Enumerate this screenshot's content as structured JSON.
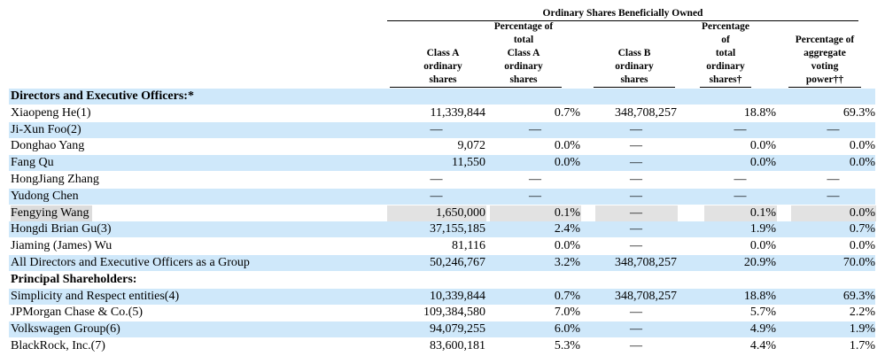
{
  "table": {
    "super_header": "Ordinary Shares Beneficially Owned",
    "columns": [
      [
        "Class A",
        "ordinary",
        "shares"
      ],
      [
        "Percentage of",
        "total",
        "Class A",
        "ordinary",
        "shares"
      ],
      [
        "Class B",
        "ordinary",
        "shares"
      ],
      [
        "Percentage",
        "of",
        "total",
        "ordinary",
        "shares†"
      ],
      [
        "Percentage of",
        "aggregate",
        "voting",
        "power††"
      ]
    ],
    "rows": [
      {
        "type": "section",
        "label": "Directors and Executive Officers:*"
      },
      {
        "label": "Xiaopeng He(1)",
        "values": [
          "11,339,844",
          "0.7%",
          "348,708,257",
          "18.8%",
          "69.3%"
        ]
      },
      {
        "label": "Ji-Xun Foo(2)",
        "values": [
          "—",
          "—",
          "—",
          "—",
          "—"
        ]
      },
      {
        "label": "Donghao Yang",
        "values": [
          "9,072",
          "0.0%",
          "—",
          "0.0%",
          "0.0%"
        ]
      },
      {
        "label": "Fang Qu",
        "values": [
          "11,550",
          "0.0%",
          "—",
          "0.0%",
          "0.0%"
        ]
      },
      {
        "label": "HongJiang Zhang",
        "values": [
          "—",
          "—",
          "—",
          "—",
          "—"
        ]
      },
      {
        "label": "Yudong Chen",
        "values": [
          "—",
          "—",
          "—",
          "—",
          "—"
        ]
      },
      {
        "label": "Fengying Wang",
        "values": [
          "1,650,000",
          "0.1%",
          "—",
          "0.1%",
          "0.0%"
        ],
        "highlight": true
      },
      {
        "label": "Hongdi Brian Gu(3)",
        "values": [
          "37,155,185",
          "2.4%",
          "—",
          "1.9%",
          "0.7%"
        ]
      },
      {
        "label": "Jiaming (James) Wu",
        "values": [
          "81,116",
          "0.0%",
          "—",
          "0.0%",
          "0.0%"
        ]
      },
      {
        "label": "All Directors and Executive Officers as a Group",
        "values": [
          "50,246,767",
          "3.2%",
          "348,708,257",
          "20.9%",
          "70.0%"
        ]
      },
      {
        "type": "section",
        "label": "Principal Shareholders:"
      },
      {
        "label": "Simplicity and Respect entities(4)",
        "values": [
          "10,339,844",
          "0.7%",
          "348,708,257",
          "18.8%",
          "69.3%"
        ]
      },
      {
        "label": "JPMorgan Chase & Co.(5)",
        "values": [
          "109,384,580",
          "7.0%",
          "—",
          "5.7%",
          "2.2%"
        ]
      },
      {
        "label": "Volkswagen Group(6)",
        "values": [
          "94,079,255",
          "6.0%",
          "—",
          "4.9%",
          "1.9%"
        ]
      },
      {
        "label": "BlackRock, Inc.(7)",
        "values": [
          "83,600,181",
          "5.3%",
          "—",
          "4.4%",
          "1.7%"
        ]
      }
    ]
  }
}
